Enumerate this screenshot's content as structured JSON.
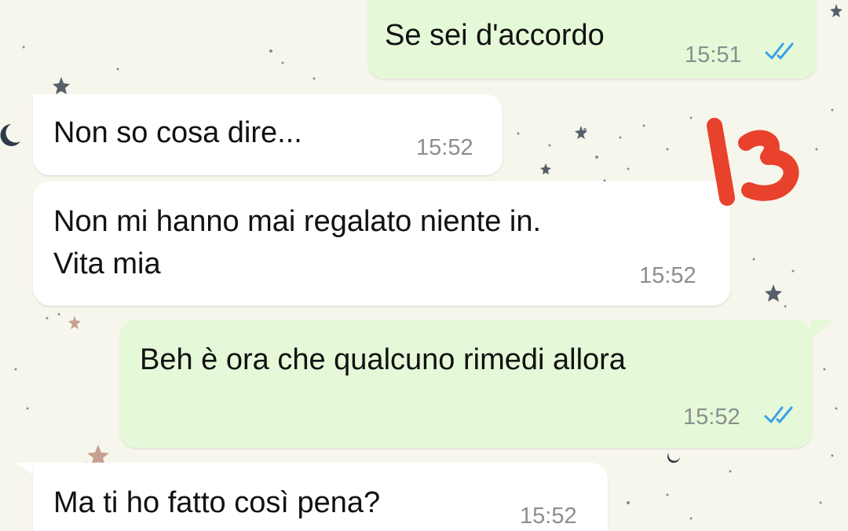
{
  "chat": {
    "messages": [
      {
        "direction": "outgoing",
        "text": "Se sei d'accordo",
        "time": "15:51",
        "status": "read"
      },
      {
        "direction": "incoming",
        "text": "Non so cosa dire...",
        "time": "15:52"
      },
      {
        "direction": "incoming",
        "text": "Non mi hanno mai regalato niente in.\nVita mia",
        "time": "15:52"
      },
      {
        "direction": "outgoing",
        "text": "Beh è ora che qualcuno rimedi allora",
        "time": "15:52",
        "status": "read"
      },
      {
        "direction": "incoming",
        "text": "Ma ti ho fatto così pena?",
        "time": "15:52"
      }
    ]
  },
  "overlay": {
    "handwritten_number": "13",
    "color": "#e8412c"
  },
  "colors": {
    "wallpaper": "#f7f6ec",
    "incoming_bubble": "#ffffff",
    "outgoing_bubble": "#e5f9d8",
    "read_ticks": "#3aa0e6",
    "time_text": "#8a8f8c"
  },
  "icons": {
    "read_receipt": "double-check-icon",
    "wallpaper_pattern": "stars-moons-doodle"
  }
}
